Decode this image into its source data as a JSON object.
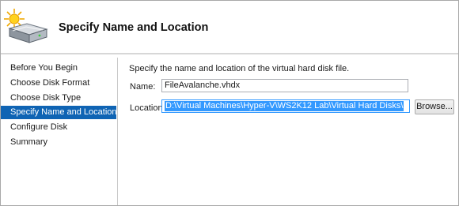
{
  "header": {
    "title": "Specify Name and Location",
    "icon": "hard-disk-new-icon"
  },
  "sidebar": {
    "items": [
      {
        "label": "Before You Begin",
        "selected": false
      },
      {
        "label": "Choose Disk Format",
        "selected": false
      },
      {
        "label": "Choose Disk Type",
        "selected": false
      },
      {
        "label": "Specify Name and Location",
        "selected": true
      },
      {
        "label": "Configure Disk",
        "selected": false
      },
      {
        "label": "Summary",
        "selected": false
      }
    ]
  },
  "main": {
    "instruction": "Specify the name and location of the virtual hard disk file.",
    "name_label": "Name:",
    "name_value": "FileAvalanche.vhdx",
    "location_label": "Location:",
    "location_value": "D:\\Virtual Machines\\Hyper-V\\WS2K12 Lab\\Virtual Hard Disks\\",
    "browse_label": "Browse..."
  },
  "colors": {
    "selection": "#0f64b4",
    "text_selection": "#3399ff"
  }
}
